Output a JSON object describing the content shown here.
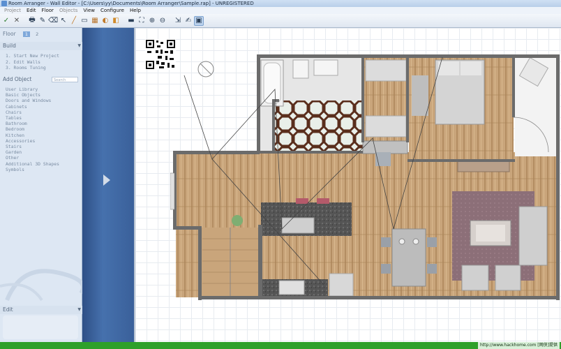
{
  "window": {
    "title": "Room Arranger - Wall Editor - [C:\\Users\\yy\\Documents\\Room Arranger\\Sample.rap] - UNREGISTERED"
  },
  "menu": {
    "items": [
      {
        "label": "Project",
        "enabled": false
      },
      {
        "label": "Edit",
        "enabled": true
      },
      {
        "label": "Floor",
        "enabled": true
      },
      {
        "label": "Objects",
        "enabled": false
      },
      {
        "label": "View",
        "enabled": true
      },
      {
        "label": "Configure",
        "enabled": true
      },
      {
        "label": "Help",
        "enabled": true
      }
    ]
  },
  "toolbar": {
    "icons": [
      "check-icon",
      "close-icon",
      "print-icon",
      "pencil-icon",
      "eraser-icon",
      "pointer-icon",
      "draw-wall-icon",
      "select-area-icon",
      "wall-texture-icon",
      "rotate-3d-icon",
      "floor-color-icon",
      "sofa-icon",
      "zoom-fit-icon",
      "zoom-in-icon",
      "zoom-out-icon",
      "snap-icon",
      "edit-icon",
      "object-library-icon"
    ]
  },
  "sidebar": {
    "floor_label": "Floor",
    "floor_tabs": [
      "1",
      "2"
    ],
    "selected_floor": "1",
    "build": {
      "title": "Build",
      "items": [
        "1. Start New Project",
        "2. Edit Walls",
        "3. Rooms Tuning"
      ]
    },
    "add_object": {
      "title": "Add Object",
      "search_placeholder": "Search",
      "items": [
        "User Library",
        "Basic Objects",
        "Doors and Windows",
        "Cabinets",
        "Chairs",
        "Tables",
        "Bathroom",
        "Bedroom",
        "Kitchen",
        "Accessories",
        "Stairs",
        "Garden",
        "Other",
        "Additional 3D Shapes",
        "Symbols"
      ]
    },
    "edit": {
      "title": "Edit"
    }
  },
  "statusbar": {
    "watermark": "http://www.hackhome.com [网侠]提供"
  },
  "colors": {
    "accent": "#7fa8da",
    "status_green": "#2ea02a",
    "panel_blue": "#3a609a",
    "wall": "#6b6b6b",
    "wood": "#c9a57b",
    "rug": "#8c6f78"
  }
}
